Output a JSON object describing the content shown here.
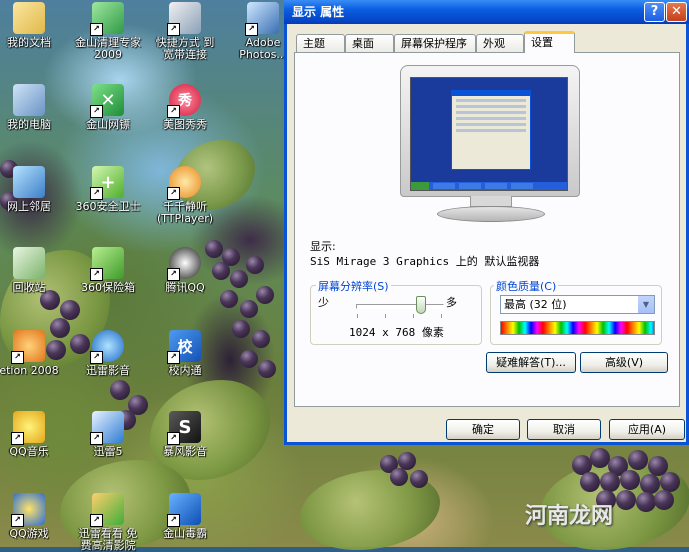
{
  "desktop": {
    "icons": [
      {
        "label": "我的文档"
      },
      {
        "label": "金山清理专家\n2009"
      },
      {
        "label": "快捷方式 到\n宽带连接"
      },
      {
        "label": "Adobe\nPhotos..."
      },
      {
        "label": "我的电脑"
      },
      {
        "label": "金山网镖"
      },
      {
        "label": "美图秀秀"
      },
      {
        "label": "网上邻居"
      },
      {
        "label": "360安全卫士"
      },
      {
        "label": "千千静听\n(TTPlayer)"
      },
      {
        "label": "回收站"
      },
      {
        "label": "360保险箱"
      },
      {
        "label": "腾讯QQ"
      },
      {
        "label": "etion 2008"
      },
      {
        "label": "迅雷影音"
      },
      {
        "label": "校内通"
      },
      {
        "label": "QQ音乐"
      },
      {
        "label": "迅雷5"
      },
      {
        "label": "暴风影音"
      },
      {
        "label": "QQ游戏"
      },
      {
        "label": "迅雷看看 免\n费高清影院"
      },
      {
        "label": "金山毒霸"
      }
    ],
    "watermark": "河南龙网"
  },
  "dialog": {
    "title": "显示 属性",
    "help_button": "?",
    "close_button": "✕",
    "tabs": [
      "主题",
      "桌面",
      "屏幕保护程序",
      "外观",
      "设置"
    ],
    "active_tab": "设置",
    "display_label": "显示:",
    "display_value": "SiS Mirage 3 Graphics 上的 默认监视器",
    "resolution": {
      "group_label": "屏幕分辨率(S)",
      "less": "少",
      "more": "多",
      "value_text": "1024 x 768 像素",
      "slider_position": 0.75
    },
    "color_quality": {
      "group_label": "颜色质量(C)",
      "selected": "最高 (32 位)"
    },
    "troubleshoot_button": "疑难解答(T)...",
    "advanced_button": "高级(V)",
    "ok_button": "确定",
    "cancel_button": "取消",
    "apply_button": "应用(A)"
  },
  "colors": {
    "titlebar": "#0a5ee0",
    "dialog_bg": "#ece9d8",
    "group_label": "#0046d5",
    "active_tab_accent": "#ffc83c"
  }
}
